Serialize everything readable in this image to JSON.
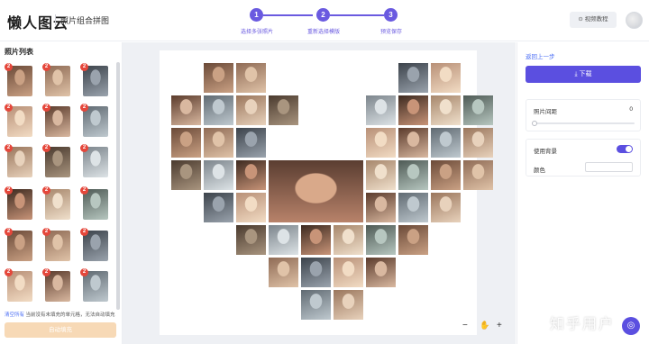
{
  "app": {
    "title": "懒人图云",
    "subtitle": "照片组合拼图"
  },
  "steps": [
    {
      "number": "1",
      "label": "选择多张照片"
    },
    {
      "number": "2",
      "label": "重新选择模版"
    },
    {
      "number": "3",
      "label": "预览保存"
    }
  ],
  "header": {
    "tutorial_label": "视频教程",
    "tutorial_icon": "play-circle-icon"
  },
  "left_panel": {
    "title": "照片列表",
    "thumb_badge": "2",
    "footer_link": "清空所有",
    "footer_text": "当前没有未填充的单元格，无法自动填充",
    "autofill_label": "自动填充"
  },
  "right_panel": {
    "back_label": "返回上一步",
    "download_label": "下载",
    "spacing_label": "照片间距",
    "spacing_value": "0",
    "use_bg_label": "使用背景",
    "use_bg_on": true,
    "color_label": "颜色"
  },
  "zoom": {
    "minus": "−",
    "hand": "✋",
    "plus": "+"
  },
  "watermark": "知乎用户",
  "colors": {
    "accent": "#5b4fe0",
    "badge": "#e5473b",
    "link": "#4b6ef5",
    "autofill_disabled": "#f7d9b6",
    "canvas_bg": "#eef0f4"
  }
}
